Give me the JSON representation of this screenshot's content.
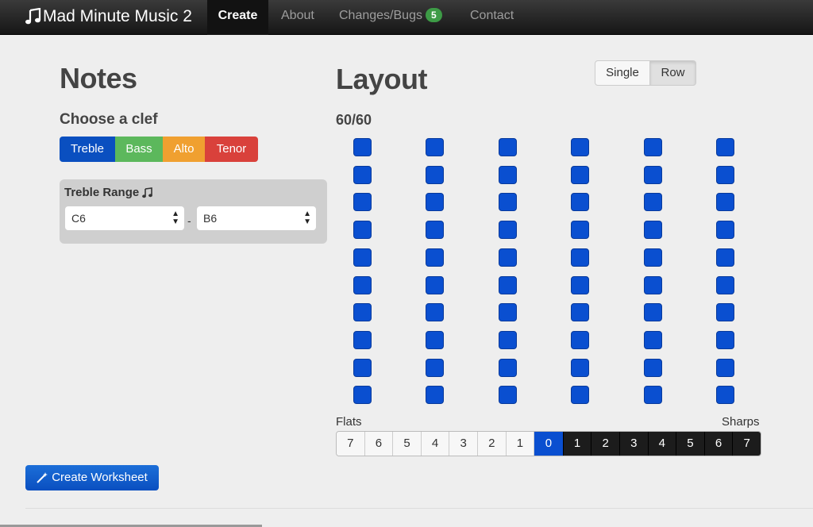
{
  "navbar": {
    "brand": "Mad Minute Music 2",
    "items": [
      {
        "label": "Create",
        "active": true
      },
      {
        "label": "About"
      },
      {
        "label": "Changes/Bugs",
        "badge": "5"
      },
      {
        "label": "Contact"
      }
    ]
  },
  "notes": {
    "title": "Notes",
    "clef_heading": "Choose a clef",
    "clefs": [
      "Treble",
      "Bass",
      "Alto",
      "Tenor"
    ],
    "range": {
      "title": "Treble Range",
      "from": "C6",
      "to": "B6",
      "separator": "-"
    }
  },
  "layout": {
    "title": "Layout",
    "toggle": {
      "single": "Single",
      "row": "Row",
      "selected": "Row"
    },
    "count": "60/60",
    "grid_rows": 10,
    "grid_cols": 6
  },
  "keys": {
    "flats_label": "Flats",
    "sharps_label": "Sharps",
    "flats": [
      "7",
      "6",
      "5",
      "4",
      "3",
      "2",
      "1"
    ],
    "zero": "0",
    "sharps": [
      "1",
      "2",
      "3",
      "4",
      "5",
      "6",
      "7"
    ]
  },
  "actions": {
    "create_label": "Create Worksheet"
  },
  "colors": {
    "primary": "#0a4fd0",
    "bass": "#5cb85c",
    "alto": "#f0a030",
    "tenor": "#d9413b"
  }
}
